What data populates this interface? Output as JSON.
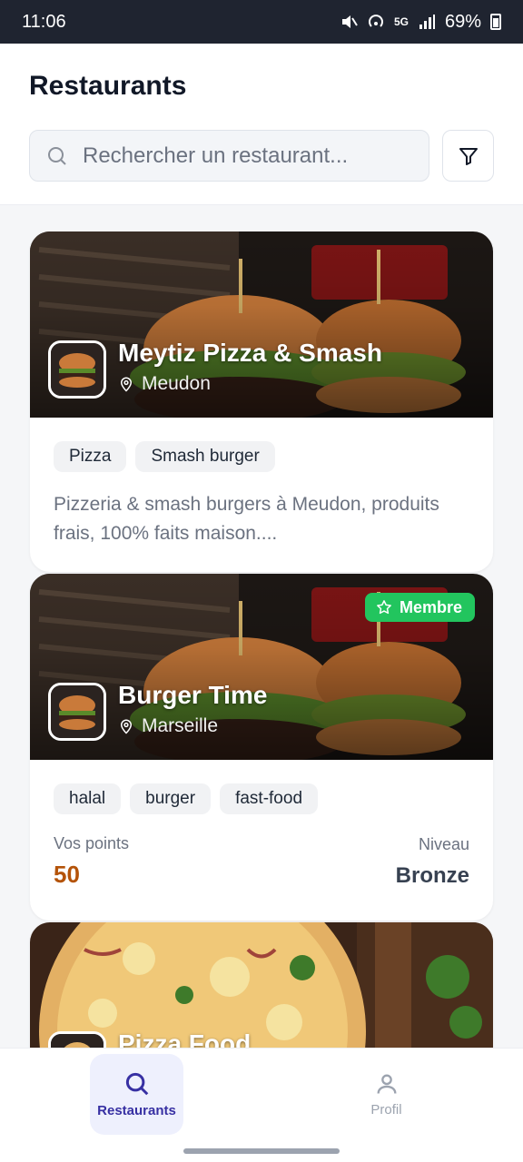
{
  "status_bar": {
    "time": "11:06",
    "battery": "69%",
    "network": "5G"
  },
  "header": {
    "title": "Restaurants",
    "search_placeholder": "Rechercher un restaurant...",
    "search_icon": "search-icon",
    "filter_icon": "filter-icon"
  },
  "restaurants": [
    {
      "name": "Meytiz Pizza & Smash",
      "city": "Meudon",
      "tags": [
        "Pizza",
        "Smash burger"
      ],
      "description": "Pizzeria & smash burgers à Meudon, produits frais, 100% faits maison...."
    },
    {
      "name": "Burger Time",
      "city": "Marseille",
      "badge": "Membre",
      "tags": [
        "halal",
        "burger",
        "fast-food"
      ],
      "points_label": "Vos points",
      "points_value": "50",
      "level_label": "Niveau",
      "level_value": "Bronze"
    },
    {
      "name": "Pizza Food"
    }
  ],
  "nav": {
    "restaurants_label": "Restaurants",
    "profile_label": "Profil"
  },
  "colors": {
    "accent": "#3730a3",
    "member_badge": "#22c55e",
    "points": "#b45309"
  }
}
